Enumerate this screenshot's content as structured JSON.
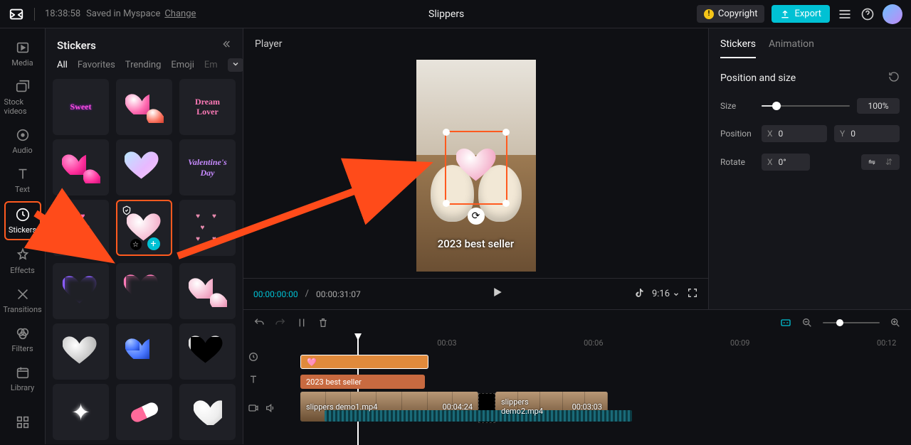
{
  "header": {
    "timestamp": "18:38:58",
    "saved_text": "Saved in Myspace",
    "change_link": "Change",
    "project_title": "Slippers",
    "copyright_label": "Copyright",
    "export_label": "Export"
  },
  "leftrail": {
    "items": [
      {
        "id": "media",
        "label": "Media"
      },
      {
        "id": "stockvideos",
        "label": "Stock videos"
      },
      {
        "id": "audio",
        "label": "Audio"
      },
      {
        "id": "text",
        "label": "Text"
      },
      {
        "id": "stickers",
        "label": "Stickers"
      },
      {
        "id": "effects",
        "label": "Effects"
      },
      {
        "id": "transitions",
        "label": "Transitions"
      },
      {
        "id": "filters",
        "label": "Filters"
      },
      {
        "id": "library",
        "label": "Library"
      }
    ]
  },
  "sticker_panel": {
    "title": "Stickers",
    "tabs": [
      "All",
      "Favorites",
      "Trending",
      "Emoji"
    ],
    "tab_overflow": "Em",
    "selected_index": 7
  },
  "player": {
    "label": "Player",
    "caption": "2023 best seller",
    "time_current": "00:00:00:00",
    "time_total": "00:00:31:07",
    "aspect": "9:16"
  },
  "right_panel": {
    "tabs": [
      "Stickers",
      "Animation"
    ],
    "section_title": "Position and size",
    "size_label": "Size",
    "size_value": "100%",
    "position_label": "Position",
    "pos_x_label": "X",
    "pos_x_value": "0",
    "pos_y_label": "Y",
    "pos_y_value": "0",
    "rotate_label": "Rotate",
    "rot_x_label": "X",
    "rot_value": "0°"
  },
  "timeline": {
    "ruler": [
      "00:03",
      "00:06",
      "00:09",
      "00:12"
    ],
    "sticker_emoji": "🩷",
    "text_clip": "2023 best seller",
    "video1_name": "slippers demo1.mp4",
    "video1_dur": "00:04:24",
    "video2_name": "slippers demo2.mp4",
    "video2_dur": "00:03:03"
  }
}
